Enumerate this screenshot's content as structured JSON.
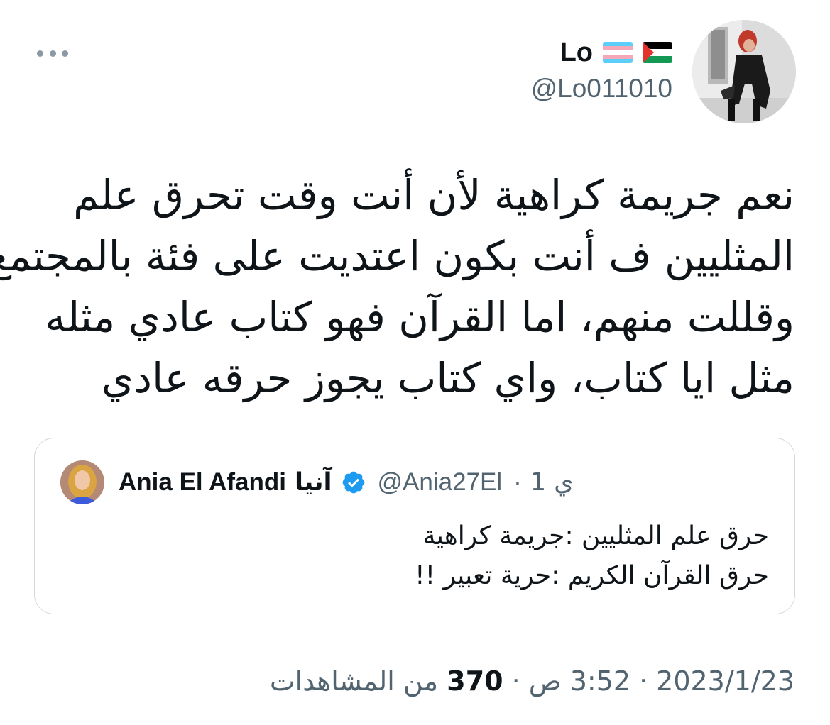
{
  "author": {
    "display_name": "Lo",
    "handle": "@Lo011010",
    "flags": [
      "transgender-flag-icon",
      "palestine-flag-icon"
    ]
  },
  "menu": {
    "more_icon": "more-horizontal-icon"
  },
  "tweet": {
    "lines": [
      "نعم جريمة كراهية لأن أنت وقت تحرق علم",
      "المثليين ف أنت بكون اعتديت على فئة بالمجتمع",
      "وقللت منهم، اما القرآن فهو كتاب عادي مثله",
      "مثل ايا كتاب، واي كتاب يجوز حرقه عادي"
    ]
  },
  "quote": {
    "display_name": "Ania El Afandi",
    "display_name_ar": "آنيا",
    "verified_icon": "verified-badge-icon",
    "handle": "@Ania27El",
    "separator": "·",
    "time": "1 ي",
    "lines": [
      "حرق علم المثليين :جريمة كراهية",
      "حرق القرآن الكريم :حرية تعبير !!"
    ]
  },
  "meta": {
    "date": "2023/1/23",
    "time": "3:52 ص",
    "views_count": "370",
    "views_label": "من المشاهدات",
    "separator": "·"
  },
  "colors": {
    "text": "#0f1419",
    "secondary": "#536471",
    "border": "#cfd9de",
    "verified": "#1d9bf0"
  }
}
